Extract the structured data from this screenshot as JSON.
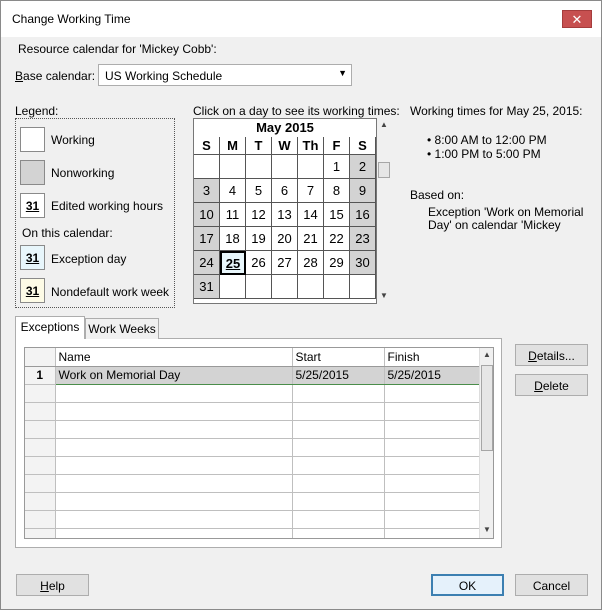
{
  "window": {
    "title": "Change Working Time",
    "close": "✕"
  },
  "resource_label": "Resource calendar for 'Mickey Cobb':",
  "base_calendar": {
    "label": "Base calendar:",
    "value": "US Working Schedule"
  },
  "legend": {
    "title": "Legend:",
    "working": "Working",
    "nonworking": "Nonworking",
    "edited_icon": "31",
    "edited": "Edited working hours",
    "on_this_calendar": "On this calendar:",
    "exception_icon": "31",
    "exception": "Exception day",
    "ndw_icon": "31",
    "ndw": "Nondefault work week"
  },
  "calendar": {
    "instruction": "Click on a day to see its working times:",
    "month": "May 2015",
    "day_headers": [
      "S",
      "M",
      "T",
      "W",
      "Th",
      "F",
      "S"
    ],
    "weeks": [
      [
        "",
        "",
        "",
        "",
        "",
        "1",
        "2"
      ],
      [
        "3",
        "4",
        "5",
        "6",
        "7",
        "8",
        "9"
      ],
      [
        "10",
        "11",
        "12",
        "13",
        "14",
        "15",
        "16"
      ],
      [
        "17",
        "18",
        "19",
        "20",
        "21",
        "22",
        "23"
      ],
      [
        "24",
        "25",
        "26",
        "27",
        "28",
        "29",
        "30"
      ],
      [
        "31",
        "",
        "",
        "",
        "",
        "",
        ""
      ]
    ],
    "selected_day": "25"
  },
  "working_times": {
    "title": "Working times for May 25, 2015:",
    "times": [
      "• 8:00 AM to 12:00 PM",
      "• 1:00 PM to 5:00 PM"
    ],
    "based_on_label": "Based on:",
    "based_on_text_1": "Exception 'Work on Memorial",
    "based_on_text_2": "Day' on calendar 'Mickey"
  },
  "tabs": [
    {
      "label": "Exceptions"
    },
    {
      "label": "Work Weeks"
    }
  ],
  "table": {
    "headers": [
      "Name",
      "Start",
      "Finish"
    ],
    "rows": [
      {
        "num": "1",
        "name": "Work on Memorial Day",
        "start": "5/25/2015",
        "finish": "5/25/2015"
      }
    ]
  },
  "buttons": {
    "details": "Details...",
    "delete": "Delete",
    "help": "Help",
    "ok": "OK",
    "cancel": "Cancel"
  },
  "colors": {
    "nonworking": "#d3d3d3",
    "exception": "#e8f6fb",
    "ndw": "#fdfbe6",
    "close": "#c75050"
  }
}
